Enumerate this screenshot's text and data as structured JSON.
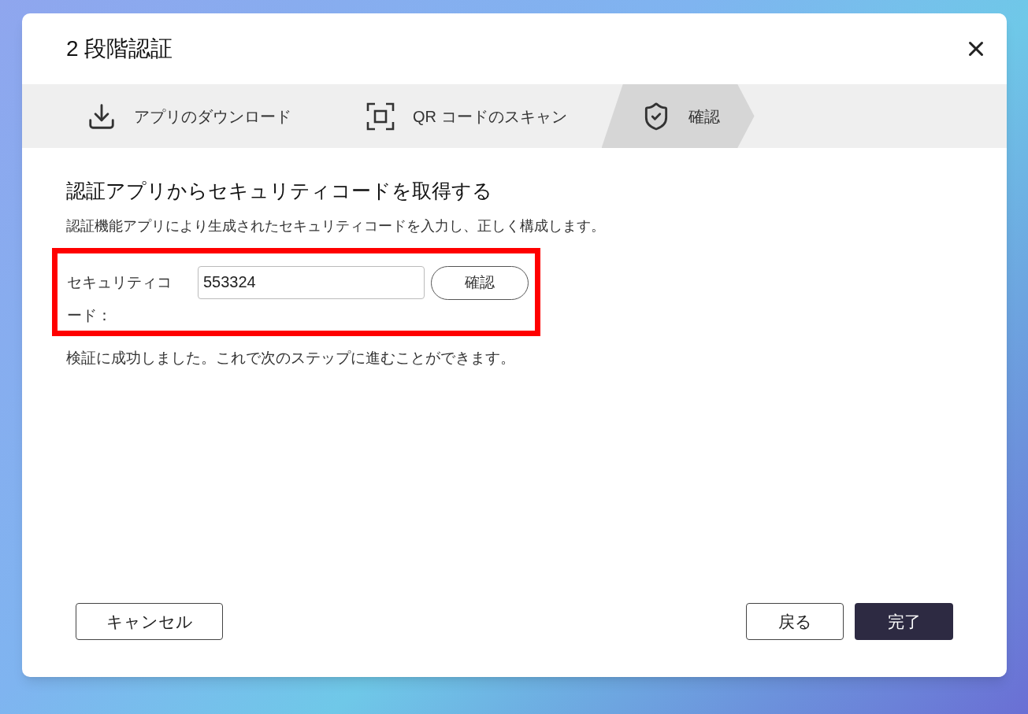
{
  "dialog": {
    "title": "2 段階認証"
  },
  "steps": [
    {
      "label": "アプリのダウンロード",
      "kind": "download",
      "selected": false
    },
    {
      "label": "QR コードのスキャン",
      "kind": "scan",
      "selected": false
    },
    {
      "label": "確認",
      "kind": "verify",
      "selected": true
    }
  ],
  "content": {
    "heading": "認証アプリからセキュリティコードを取得する",
    "description": "認証機能アプリにより生成されたセキュリティコードを入力し、正しく構成します。",
    "field": {
      "label": "セキュリティコード：",
      "value": "553324",
      "highlighted": true
    },
    "verify_button": "確認",
    "message": "検証に成功しました。これで次のステップに進むことができます。"
  },
  "footer": {
    "cancel": "キャンセル",
    "back": "戻る",
    "finish": "完了"
  }
}
